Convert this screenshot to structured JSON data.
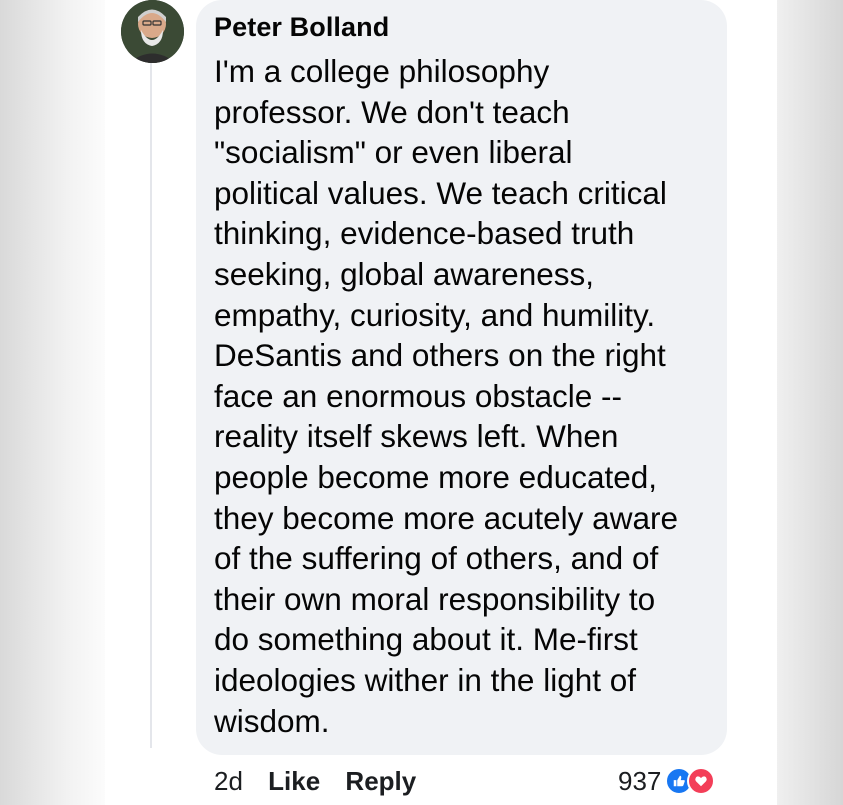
{
  "comment": {
    "author": "Peter Bolland",
    "lines": [
      "I'm a college philosophy",
      "professor. We don't teach",
      "\"socialism\" or even liberal",
      "political values. We teach critical",
      "thinking, evidence-based truth",
      "seeking, global awareness,",
      "empathy, curiosity, and humility.",
      "DeSantis and others on the right",
      "face an enormous obstacle --",
      "reality itself skews left. When",
      "people become more educated,",
      "they become more acutely aware",
      "of the suffering of others, and of",
      "their own moral responsibility to",
      "do something about it. Me-first",
      "ideologies wither in the light of",
      "wisdom."
    ]
  },
  "actions": {
    "timestamp": "2d",
    "like_label": "Like",
    "reply_label": "Reply"
  },
  "reactions": {
    "count": "937",
    "icons": [
      "like-icon",
      "love-icon"
    ]
  },
  "colors": {
    "bubble": "#f0f2f5",
    "like": "#1877f2",
    "love": "#f33e58",
    "text": "#050505"
  }
}
